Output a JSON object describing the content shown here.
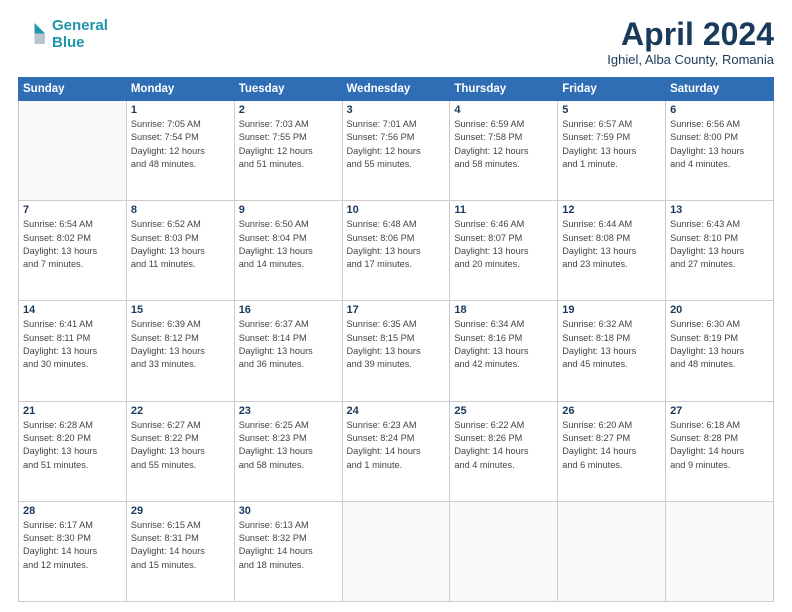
{
  "header": {
    "logo_line1": "General",
    "logo_line2": "Blue",
    "month": "April 2024",
    "location": "Ighiel, Alba County, Romania"
  },
  "days_of_week": [
    "Sunday",
    "Monday",
    "Tuesday",
    "Wednesday",
    "Thursday",
    "Friday",
    "Saturday"
  ],
  "weeks": [
    [
      {
        "day": "",
        "info": ""
      },
      {
        "day": "1",
        "info": "Sunrise: 7:05 AM\nSunset: 7:54 PM\nDaylight: 12 hours\nand 48 minutes."
      },
      {
        "day": "2",
        "info": "Sunrise: 7:03 AM\nSunset: 7:55 PM\nDaylight: 12 hours\nand 51 minutes."
      },
      {
        "day": "3",
        "info": "Sunrise: 7:01 AM\nSunset: 7:56 PM\nDaylight: 12 hours\nand 55 minutes."
      },
      {
        "day": "4",
        "info": "Sunrise: 6:59 AM\nSunset: 7:58 PM\nDaylight: 12 hours\nand 58 minutes."
      },
      {
        "day": "5",
        "info": "Sunrise: 6:57 AM\nSunset: 7:59 PM\nDaylight: 13 hours\nand 1 minute."
      },
      {
        "day": "6",
        "info": "Sunrise: 6:56 AM\nSunset: 8:00 PM\nDaylight: 13 hours\nand 4 minutes."
      }
    ],
    [
      {
        "day": "7",
        "info": "Sunrise: 6:54 AM\nSunset: 8:02 PM\nDaylight: 13 hours\nand 7 minutes."
      },
      {
        "day": "8",
        "info": "Sunrise: 6:52 AM\nSunset: 8:03 PM\nDaylight: 13 hours\nand 11 minutes."
      },
      {
        "day": "9",
        "info": "Sunrise: 6:50 AM\nSunset: 8:04 PM\nDaylight: 13 hours\nand 14 minutes."
      },
      {
        "day": "10",
        "info": "Sunrise: 6:48 AM\nSunset: 8:06 PM\nDaylight: 13 hours\nand 17 minutes."
      },
      {
        "day": "11",
        "info": "Sunrise: 6:46 AM\nSunset: 8:07 PM\nDaylight: 13 hours\nand 20 minutes."
      },
      {
        "day": "12",
        "info": "Sunrise: 6:44 AM\nSunset: 8:08 PM\nDaylight: 13 hours\nand 23 minutes."
      },
      {
        "day": "13",
        "info": "Sunrise: 6:43 AM\nSunset: 8:10 PM\nDaylight: 13 hours\nand 27 minutes."
      }
    ],
    [
      {
        "day": "14",
        "info": "Sunrise: 6:41 AM\nSunset: 8:11 PM\nDaylight: 13 hours\nand 30 minutes."
      },
      {
        "day": "15",
        "info": "Sunrise: 6:39 AM\nSunset: 8:12 PM\nDaylight: 13 hours\nand 33 minutes."
      },
      {
        "day": "16",
        "info": "Sunrise: 6:37 AM\nSunset: 8:14 PM\nDaylight: 13 hours\nand 36 minutes."
      },
      {
        "day": "17",
        "info": "Sunrise: 6:35 AM\nSunset: 8:15 PM\nDaylight: 13 hours\nand 39 minutes."
      },
      {
        "day": "18",
        "info": "Sunrise: 6:34 AM\nSunset: 8:16 PM\nDaylight: 13 hours\nand 42 minutes."
      },
      {
        "day": "19",
        "info": "Sunrise: 6:32 AM\nSunset: 8:18 PM\nDaylight: 13 hours\nand 45 minutes."
      },
      {
        "day": "20",
        "info": "Sunrise: 6:30 AM\nSunset: 8:19 PM\nDaylight: 13 hours\nand 48 minutes."
      }
    ],
    [
      {
        "day": "21",
        "info": "Sunrise: 6:28 AM\nSunset: 8:20 PM\nDaylight: 13 hours\nand 51 minutes."
      },
      {
        "day": "22",
        "info": "Sunrise: 6:27 AM\nSunset: 8:22 PM\nDaylight: 13 hours\nand 55 minutes."
      },
      {
        "day": "23",
        "info": "Sunrise: 6:25 AM\nSunset: 8:23 PM\nDaylight: 13 hours\nand 58 minutes."
      },
      {
        "day": "24",
        "info": "Sunrise: 6:23 AM\nSunset: 8:24 PM\nDaylight: 14 hours\nand 1 minute."
      },
      {
        "day": "25",
        "info": "Sunrise: 6:22 AM\nSunset: 8:26 PM\nDaylight: 14 hours\nand 4 minutes."
      },
      {
        "day": "26",
        "info": "Sunrise: 6:20 AM\nSunset: 8:27 PM\nDaylight: 14 hours\nand 6 minutes."
      },
      {
        "day": "27",
        "info": "Sunrise: 6:18 AM\nSunset: 8:28 PM\nDaylight: 14 hours\nand 9 minutes."
      }
    ],
    [
      {
        "day": "28",
        "info": "Sunrise: 6:17 AM\nSunset: 8:30 PM\nDaylight: 14 hours\nand 12 minutes."
      },
      {
        "day": "29",
        "info": "Sunrise: 6:15 AM\nSunset: 8:31 PM\nDaylight: 14 hours\nand 15 minutes."
      },
      {
        "day": "30",
        "info": "Sunrise: 6:13 AM\nSunset: 8:32 PM\nDaylight: 14 hours\nand 18 minutes."
      },
      {
        "day": "",
        "info": ""
      },
      {
        "day": "",
        "info": ""
      },
      {
        "day": "",
        "info": ""
      },
      {
        "day": "",
        "info": ""
      }
    ]
  ]
}
